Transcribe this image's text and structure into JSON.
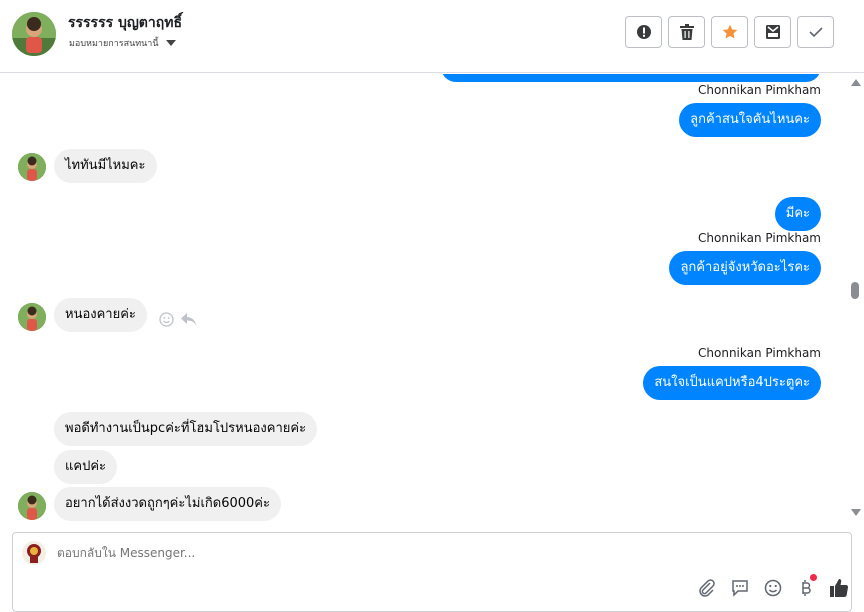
{
  "header": {
    "contact_name": "รรรรรร บุญตาฤทธิ์",
    "assign_label": "มอบหมายการสนทนานี้",
    "actions": [
      "spam-icon",
      "trash-icon",
      "star-icon",
      "archive-icon",
      "done-icon"
    ],
    "star_color": "#f7923b"
  },
  "messages": [
    {
      "side": "out",
      "sender": "Chonnikan Pimkham",
      "text": "ลูกค้าสนใจคันไหนคะ"
    },
    {
      "side": "in",
      "text": "ไททันมีไหมคะ"
    },
    {
      "side": "out",
      "text": "มีคะ"
    },
    {
      "side": "out",
      "sender": "Chonnikan Pimkham",
      "text": "ลูกค้าอยู่จังหวัดอะไรคะ"
    },
    {
      "side": "in",
      "text": "หนองคายค่ะ"
    },
    {
      "side": "out",
      "sender": "Chonnikan Pimkham",
      "text": "สนใจเป็นแคปหรือ4ประตูคะ"
    },
    {
      "side": "in",
      "text": "พอดีทำงานเป็นpcค่ะที่โฮมโปรหนองคายค่ะ"
    },
    {
      "side": "in",
      "text": "แคปค่ะ"
    },
    {
      "side": "in",
      "text": "อยากได้ส่งงวดถูกๆค่ะไม่เกิด6000ค่ะ"
    }
  ],
  "composer": {
    "placeholder": "ตอบกลับใน Messenger...",
    "tools": [
      "attach-icon",
      "saved-reply-icon",
      "emoji-icon",
      "baht-icon",
      "like-icon"
    ]
  },
  "colors": {
    "outgoing": "#0084ff",
    "incoming": "#f0f0f0",
    "notification": "#f02849"
  }
}
